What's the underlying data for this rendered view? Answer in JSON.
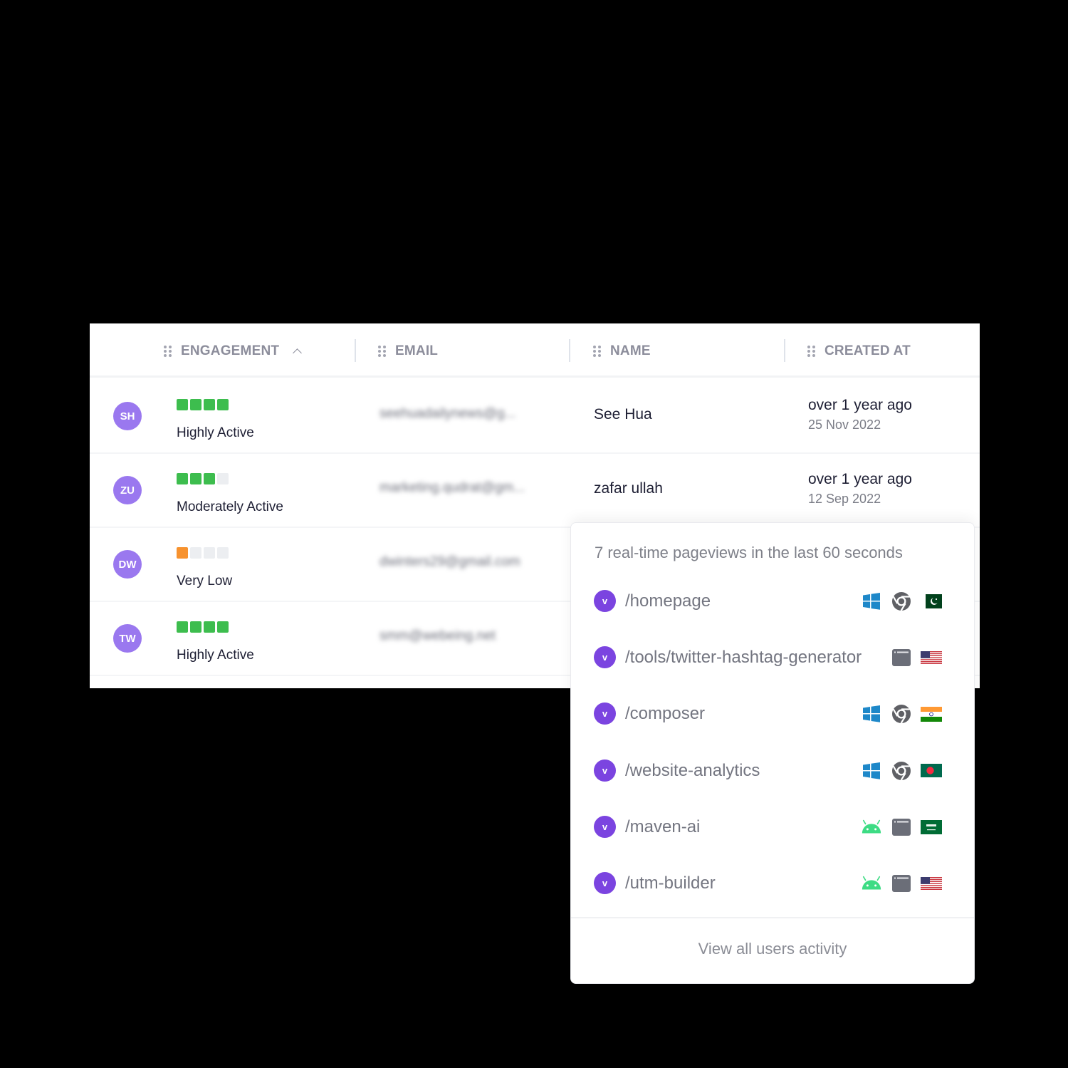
{
  "table": {
    "columns": [
      {
        "label": "ENGAGEMENT",
        "sorted": "ascending"
      },
      {
        "label": "EMAIL"
      },
      {
        "label": "NAME"
      },
      {
        "label": "CREATED AT"
      }
    ],
    "rows": [
      {
        "initials": "SH",
        "engagement_label": "Highly Active",
        "engagement_level": 4,
        "engagement_max": 4,
        "engagement_color": "#3dbd4e",
        "email": "seehuadailynews@g...",
        "name": "See Hua",
        "created_relative": "over 1 year ago",
        "created_date": "25 Nov 2022"
      },
      {
        "initials": "ZU",
        "engagement_label": "Moderately Active",
        "engagement_level": 3,
        "engagement_max": 4,
        "engagement_color": "#3dbd4e",
        "email": "marketing.qudrat@gm...",
        "name": "zafar ullah",
        "created_relative": "over 1 year ago",
        "created_date": "12 Sep 2022"
      },
      {
        "initials": "DW",
        "engagement_label": "Very Low",
        "engagement_level": 1,
        "engagement_max": 4,
        "engagement_color": "#f7922e",
        "email": "dwinters29@gmail.com",
        "name": "",
        "created_relative": "",
        "created_date": ""
      },
      {
        "initials": "TW",
        "engagement_label": "Highly Active",
        "engagement_level": 4,
        "engagement_max": 4,
        "engagement_color": "#3dbd4e",
        "email": "smm@webeing.net",
        "name": "",
        "created_relative": "",
        "created_date": ""
      }
    ]
  },
  "realtime": {
    "title": "7 real-time pageviews in the last 60 seconds",
    "badge_letter": "v",
    "items": [
      {
        "path": "/homepage",
        "icons": [
          "windows-icon",
          "chrome-icon",
          "flag-pakistan-icon"
        ]
      },
      {
        "path": "/tools/twitter-hashtag-generator",
        "icons": [
          "browser-window-icon",
          "flag-usa-icon"
        ]
      },
      {
        "path": "/composer",
        "icons": [
          "windows-icon",
          "chrome-icon",
          "flag-india-icon"
        ]
      },
      {
        "path": "/website-analytics",
        "icons": [
          "windows-icon",
          "chrome-icon",
          "flag-bangladesh-icon"
        ]
      },
      {
        "path": "/maven-ai",
        "icons": [
          "android-icon",
          "browser-window-icon",
          "flag-saudi-arabia-icon"
        ]
      },
      {
        "path": "/utm-builder",
        "icons": [
          "android-icon",
          "browser-window-icon",
          "flag-usa-icon"
        ]
      }
    ],
    "view_all_label": "View all users activity"
  },
  "colors": {
    "avatar": "#9a78ef",
    "badge": "#7b44e0",
    "bar_empty": "#eceef1"
  }
}
